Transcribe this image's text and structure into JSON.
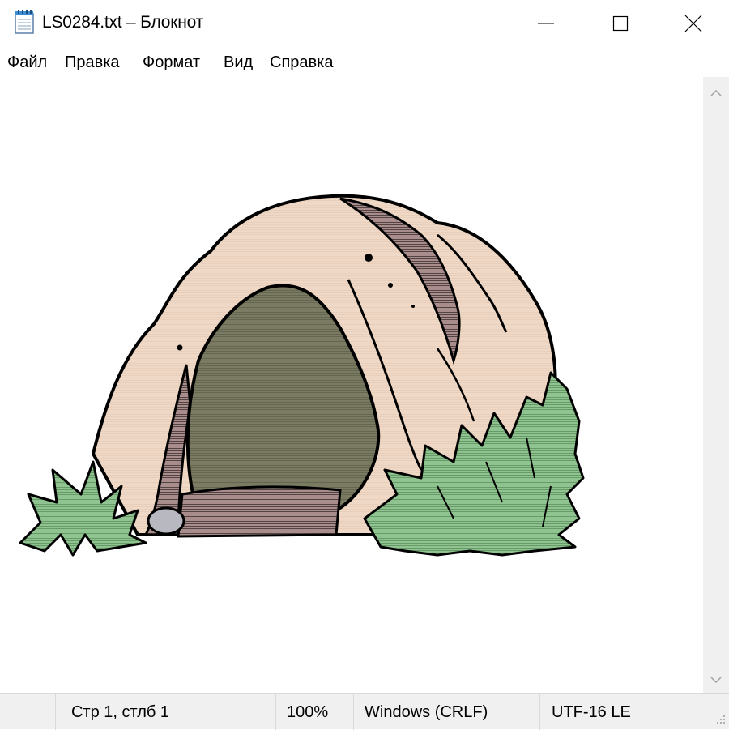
{
  "window": {
    "title": "LS0284.txt – Блокнот",
    "icon": "notepad-icon"
  },
  "menu": {
    "items": [
      "Файл",
      "Правка",
      "Формат",
      "Вид",
      "Справка"
    ]
  },
  "editor": {
    "content": "cave-clipart-image"
  },
  "status": {
    "position": "Стр 1, стлб 1",
    "zoom": "100%",
    "line_endings": "Windows (CRLF)",
    "encoding": "UTF-16 LE"
  },
  "colors": {
    "rock": "#efd9c6",
    "cave_opening": "#7a7b62",
    "grass": "#8fc38f",
    "ground": "#8b6e6e",
    "stone": "#b8b8c0"
  }
}
